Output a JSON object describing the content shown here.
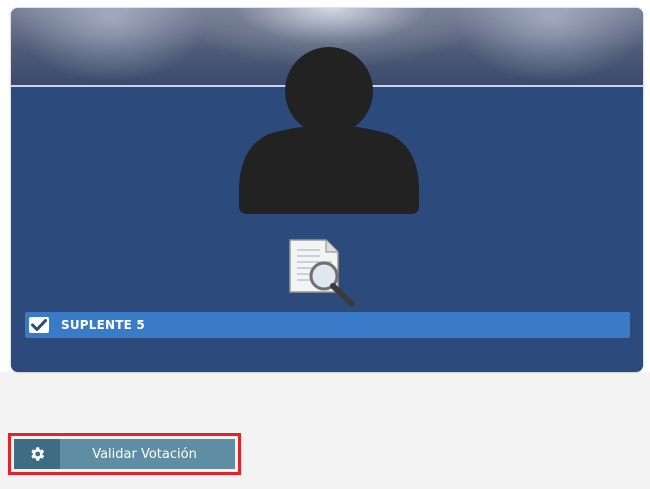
{
  "card": {
    "name_label": "SUPLENTE 5",
    "checked": true,
    "avatar_icon": "user-silhouette-icon",
    "document_icon": "document-search-icon"
  },
  "actions": {
    "validate_label": "Validar Votación",
    "validate_icon": "gear-icon",
    "highlight_color": "#e1232a"
  },
  "colors": {
    "card_background": "#2c4b7c",
    "name_bar": "#3a7bc8",
    "button_background": "#5f8ea4",
    "button_icon_background": "#3e6d83"
  }
}
